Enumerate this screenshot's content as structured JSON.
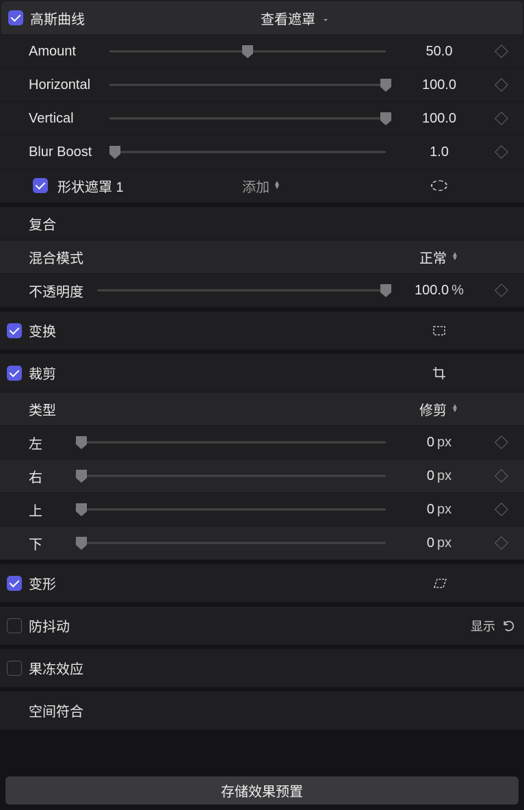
{
  "gaussian": {
    "title": "高斯曲线",
    "view_mask": "查看遮罩",
    "amount": {
      "label": "Amount",
      "value": "50.0",
      "pct": 50
    },
    "horizontal": {
      "label": "Horizontal",
      "value": "100.0",
      "pct": 100
    },
    "vertical": {
      "label": "Vertical",
      "value": "100.0",
      "pct": 100
    },
    "blur_boost": {
      "label": "Blur Boost",
      "value": "1.0",
      "pct": 2
    },
    "shape_mask": {
      "label": "形状遮罩 1",
      "mode": "添加"
    }
  },
  "composite": {
    "title": "复合",
    "blend_mode": {
      "label": "混合模式",
      "value": "正常"
    },
    "opacity": {
      "label": "不透明度",
      "value": "100.0",
      "unit": "%",
      "pct": 100
    }
  },
  "transform": {
    "title": "变换"
  },
  "crop": {
    "title": "裁剪",
    "type": {
      "label": "类型",
      "value": "修剪"
    },
    "left": {
      "label": "左",
      "value": "0",
      "unit": "px",
      "pct": 2
    },
    "right": {
      "label": "右",
      "value": "0",
      "unit": "px",
      "pct": 2
    },
    "top": {
      "label": "上",
      "value": "0",
      "unit": "px",
      "pct": 2
    },
    "bottom": {
      "label": "下",
      "value": "0",
      "unit": "px",
      "pct": 2
    }
  },
  "distort": {
    "title": "变形"
  },
  "stabilize": {
    "title": "防抖动",
    "show": "显示"
  },
  "rolling": {
    "title": "果冻效应"
  },
  "spatial": {
    "title": "空间符合"
  },
  "footer": {
    "save": "存储效果预置"
  }
}
